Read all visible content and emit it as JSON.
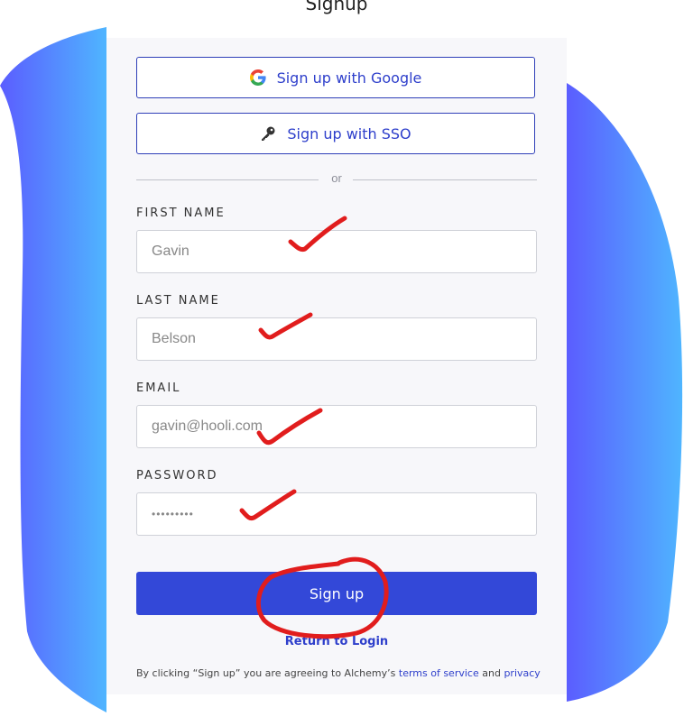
{
  "page": {
    "title": "Signup"
  },
  "oauth": {
    "google_label": "Sign up with Google",
    "sso_label": "Sign up with SSO",
    "divider_text": "or"
  },
  "form": {
    "fields": [
      {
        "label": "FIRST NAME",
        "value": "Gavin"
      },
      {
        "label": "LAST NAME",
        "value": "Belson"
      },
      {
        "label": "EMAIL",
        "value": "gavin@hooli.com"
      },
      {
        "label": "PASSWORD",
        "value": "•••••••••"
      }
    ],
    "submit_label": "Sign up"
  },
  "footer": {
    "return_label": "Return to Login",
    "terms_prefix": "By clicking “Sign up” you are agreeing to Alchemy’s ",
    "terms_link": "terms of service",
    "terms_and": " and ",
    "privacy_link": "privacy"
  },
  "colors": {
    "accent": "#3348d8",
    "link": "#2e3fcb",
    "annotation": "#e11d1d",
    "blob_left": "#5a5cff",
    "blob_right": "#4fb3ff"
  },
  "icons": {
    "google": "google-icon",
    "sso": "key-icon"
  }
}
